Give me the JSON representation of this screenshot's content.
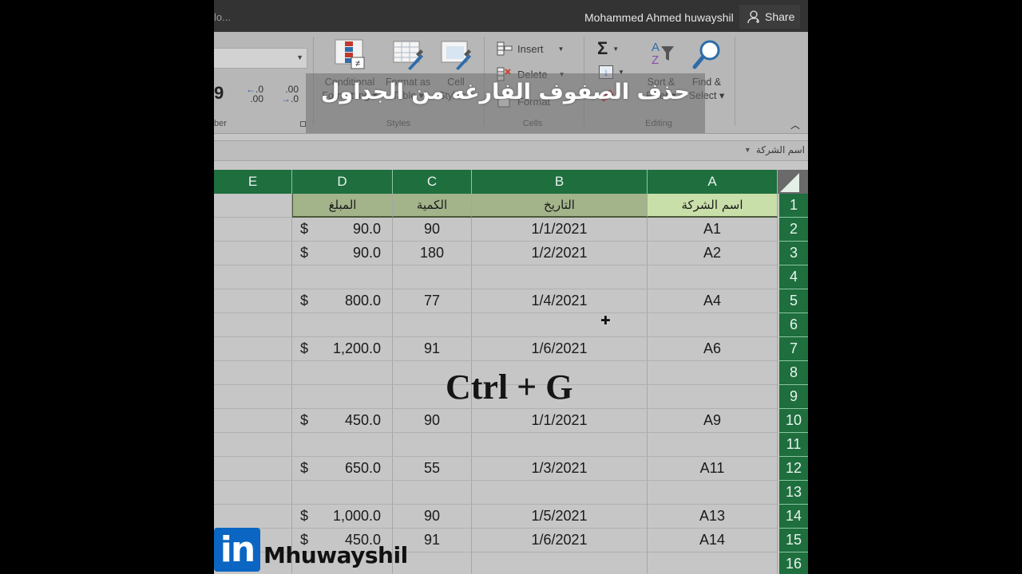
{
  "titlebar": {
    "tell_me": "lo...",
    "user_name": "Mohammed Ahmed huwayshil",
    "share_label": "Share"
  },
  "ribbon": {
    "number_group_label": "ber",
    "comma_style": "9",
    "increase_decimal": {
      "top": ".0",
      "bottom": ".00"
    },
    "decrease_decimal": {
      "top": ".00",
      "bottom": ".0"
    },
    "styles": {
      "label": "Styles",
      "conditional_formatting": {
        "line1": "Conditional",
        "line2": "Formatting ▾"
      },
      "format_as_table": {
        "line1": "Format as",
        "line2": "Table ▾"
      },
      "cell_styles": {
        "line1": "Cell",
        "line2": "Styles ▾"
      }
    },
    "cells": {
      "label": "Cells",
      "insert": "Insert",
      "delete": "Delete",
      "format": "Format"
    },
    "editing": {
      "label": "Editing",
      "sort_filter": {
        "line1": "Sort &",
        "line2": "Filter ▾"
      },
      "find_select": {
        "line1": "Find &",
        "line2": "Select ▾"
      }
    }
  },
  "overlay": {
    "banner_text": "حذف الصفوف الفارغه من الجداول",
    "shortcut_text": "Ctrl + G"
  },
  "formula_bar": {
    "name_box": "اسم الشركة"
  },
  "sheet": {
    "columns": [
      "E",
      "D",
      "C",
      "B",
      "A"
    ],
    "header_row": {
      "row": "1",
      "D": "المبلغ",
      "C": "الكمية",
      "B": "التاريخ",
      "A": "اسم الشركة"
    },
    "rows": [
      {
        "row": "2",
        "D_sym": "$",
        "D": "90.0",
        "C": "90",
        "B": "1/1/2021",
        "A": "A1"
      },
      {
        "row": "3",
        "D_sym": "$",
        "D": "90.0",
        "C": "180",
        "B": "1/2/2021",
        "A": "A2"
      },
      {
        "row": "4",
        "D_sym": "",
        "D": "",
        "C": "",
        "B": "",
        "A": ""
      },
      {
        "row": "5",
        "D_sym": "$",
        "D": "800.0",
        "C": "77",
        "B": "1/4/2021",
        "A": "A4"
      },
      {
        "row": "6",
        "D_sym": "",
        "D": "",
        "C": "",
        "B": "",
        "A": ""
      },
      {
        "row": "7",
        "D_sym": "$",
        "D": "1,200.0",
        "C": "91",
        "B": "1/6/2021",
        "A": "A6"
      },
      {
        "row": "8",
        "D_sym": "",
        "D": "",
        "C": "",
        "B": "",
        "A": ""
      },
      {
        "row": "9",
        "D_sym": "",
        "D": "",
        "C": "",
        "B": "",
        "A": ""
      },
      {
        "row": "10",
        "D_sym": "$",
        "D": "450.0",
        "C": "90",
        "B": "1/1/2021",
        "A": "A9"
      },
      {
        "row": "11",
        "D_sym": "",
        "D": "",
        "C": "",
        "B": "",
        "A": ""
      },
      {
        "row": "12",
        "D_sym": "$",
        "D": "650.0",
        "C": "55",
        "B": "1/3/2021",
        "A": "A11"
      },
      {
        "row": "13",
        "D_sym": "",
        "D": "",
        "C": "",
        "B": "",
        "A": ""
      },
      {
        "row": "14",
        "D_sym": "$",
        "D": "1,000.0",
        "C": "90",
        "B": "1/5/2021",
        "A": "A13"
      },
      {
        "row": "15",
        "D_sym": "$",
        "D": "450.0",
        "C": "91",
        "B": "1/6/2021",
        "A": "A14"
      },
      {
        "row": "16",
        "D_sym": "",
        "D": "",
        "C": "",
        "B": "",
        "A": ""
      }
    ]
  },
  "watermark": {
    "logo": "in",
    "name": "Mhuwayshil"
  },
  "colors": {
    "header_green": "#1e6e3e",
    "header_row_fill_A": "#c9dfa9",
    "header_row_fill": "#a3b38a",
    "linkedin_blue": "#0a66c2"
  }
}
